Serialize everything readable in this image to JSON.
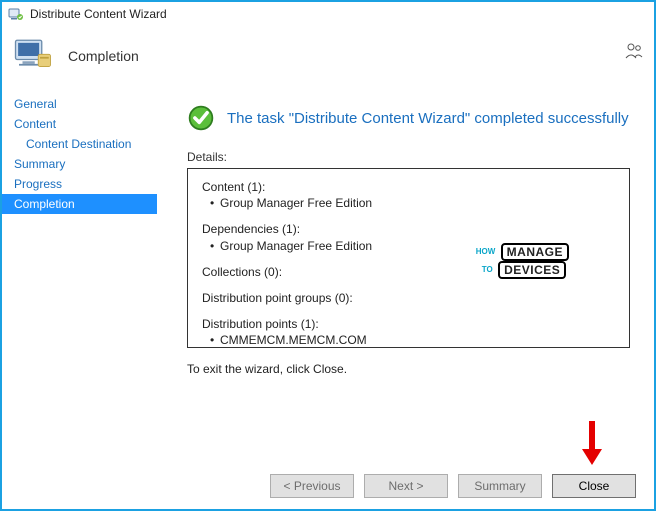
{
  "window": {
    "title": "Distribute Content Wizard"
  },
  "header": {
    "title": "Completion"
  },
  "sidebar": {
    "items": [
      {
        "label": "General",
        "indent": false,
        "selected": false
      },
      {
        "label": "Content",
        "indent": false,
        "selected": false
      },
      {
        "label": "Content Destination",
        "indent": true,
        "selected": false
      },
      {
        "label": "Summary",
        "indent": false,
        "selected": false
      },
      {
        "label": "Progress",
        "indent": false,
        "selected": false
      },
      {
        "label": "Completion",
        "indent": false,
        "selected": true
      }
    ]
  },
  "main": {
    "result_text": "The task \"Distribute Content Wizard\" completed successfully",
    "details_label": "Details:",
    "details": {
      "content_header": "Content (1):",
      "content_items": [
        "Group Manager Free Edition"
      ],
      "dependencies_header": "Dependencies (1):",
      "dependencies_items": [
        "Group Manager Free Edition"
      ],
      "collections_header": "Collections (0):",
      "dpg_header": "Distribution point groups (0):",
      "dp_header": "Distribution points (1):",
      "dp_items": [
        "CMMEMCM.MEMCM.COM"
      ]
    },
    "exit_text": "To exit the wizard, click Close."
  },
  "watermark": {
    "small1": "HOW",
    "small2": "TO",
    "big1": "MANAGE",
    "big2": "DEVICES"
  },
  "footer": {
    "previous": "< Previous",
    "next": "Next >",
    "summary": "Summary",
    "close": "Close"
  }
}
